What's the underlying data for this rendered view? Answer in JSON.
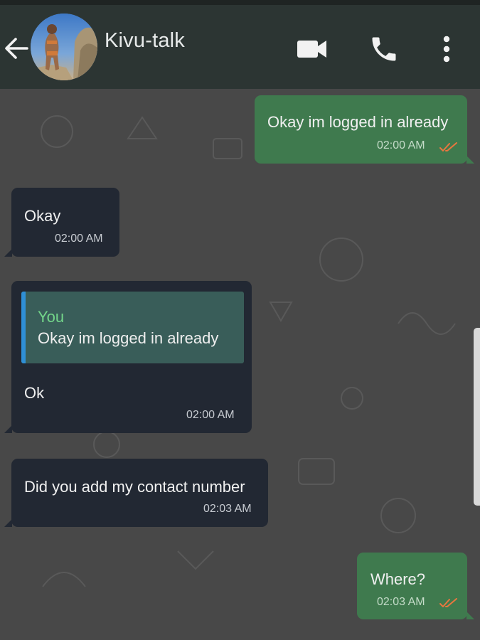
{
  "header": {
    "contact_name": "Kivu-talk",
    "icons": {
      "back": "arrow-left-icon",
      "avatar": "contact-avatar",
      "video": "video-camera-icon",
      "call": "phone-icon",
      "menu": "vertical-dots-icon"
    }
  },
  "messages": [
    {
      "direction": "outgoing",
      "text": "Okay im logged in already",
      "time": "02:00 AM",
      "status": "read"
    },
    {
      "direction": "incoming",
      "text": "Okay",
      "time": "02:00 AM"
    },
    {
      "direction": "incoming",
      "reply_to": {
        "author": "You",
        "text": "Okay im logged in already"
      },
      "text": "Ok",
      "time": "02:00 AM"
    },
    {
      "direction": "incoming",
      "text": "Did you add my contact number",
      "time": "02:03 AM"
    },
    {
      "direction": "outgoing",
      "text": "Where?",
      "time": "02:03 AM",
      "status": "read"
    }
  ],
  "colors": {
    "header_bg": "#2c3533",
    "chat_bg": "#484848",
    "incoming_bubble": "#222833",
    "outgoing_bubble": "#3f7a4e",
    "read_ticks": "#e8763f",
    "quote_author": "#73d68a",
    "quote_bar": "#2f8fd6"
  }
}
